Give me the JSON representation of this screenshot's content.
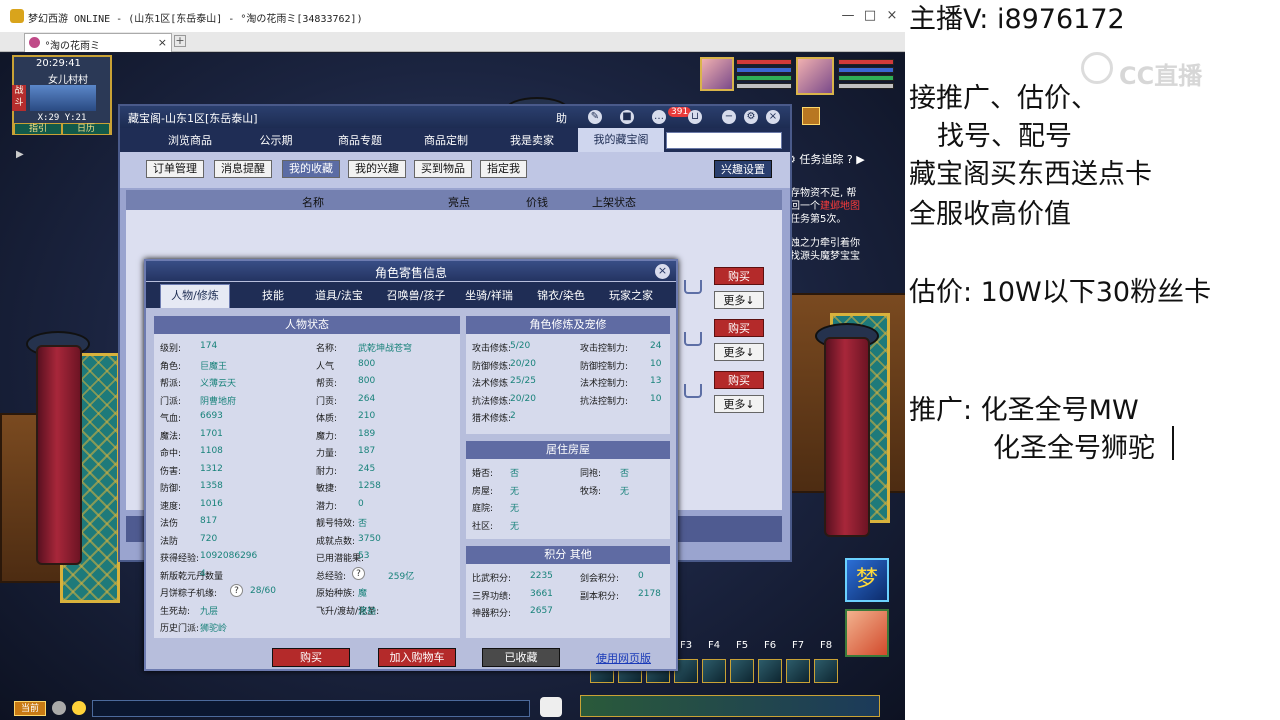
{
  "window": {
    "title": "梦幻西游 ONLINE - (山东1区[东岳泰山] - °淘の花雨ミ[34833762])",
    "tab_title": "°淘の花雨ミ",
    "tab_close": "×",
    "tab_add": "+",
    "min": "—",
    "max": "□",
    "close": "×"
  },
  "hud": {
    "time": "20:29:41",
    "location": "女儿村村",
    "coords": "X:29  Y:21",
    "side_tag": "战斗",
    "map_btns": [
      "指引",
      "日历"
    ],
    "quest_tracker": "任务追踪",
    "quest_line1": "存物资不足, 帮",
    "quest_line2": "回一个",
    "quest_hl1": "建邺地图",
    "quest_line3": "任务第5次。",
    "quest_line4": "蚀之力牵引着你",
    "quest_line5": "找源头",
    "quest_hl2": "魔梦宝宝",
    "chat_label": "当前",
    "fkeys": [
      "F3",
      "F4",
      "F5",
      "F6",
      "F7",
      "F8"
    ]
  },
  "shop": {
    "title": "藏宝阁-山东1区[东岳泰山]",
    "help": "助",
    "cart_badge": "391",
    "nav": [
      "浏览商品",
      "公示期",
      "商品专题",
      "商品定制",
      "我是卖家",
      "我的藏宝阁"
    ],
    "sub": [
      "订单管理",
      "消息提醒",
      "我的收藏",
      "我的兴趣",
      "买到物品",
      "指定我"
    ],
    "interest_settings": "兴趣设置",
    "columns": [
      "名称",
      "亮点",
      "价钱",
      "上架状态"
    ],
    "buy": "购买",
    "more": "更多↓"
  },
  "dialog": {
    "title": "角色寄售信息",
    "close": "×",
    "tabs": [
      "人物/修炼",
      "技能",
      "道具/法宝",
      "召唤兽/孩子",
      "坐骑/祥瑞",
      "锦衣/染色",
      "玩家之家"
    ],
    "status_header": "人物状态",
    "cultivation_header": "角色修炼及宠修",
    "housing_header": "居住房屋",
    "points_header": "积分 其他",
    "left_col": [
      [
        "级别:",
        "174"
      ],
      [
        "角色:",
        "巨魔王"
      ],
      [
        "帮派:",
        "义薄云天"
      ],
      [
        "门派:",
        "阴曹地府"
      ],
      [
        "气血:",
        "6693"
      ],
      [
        "魔法:",
        "1701"
      ],
      [
        "命中:",
        "1108"
      ],
      [
        "伤害:",
        "1312"
      ],
      [
        "防御:",
        "1358"
      ],
      [
        "速度:",
        "1016"
      ],
      [
        "法伤",
        "817"
      ],
      [
        "法防",
        "720"
      ],
      [
        "获得经验:",
        "1092086296"
      ],
      [
        "新版乾元丹数量",
        "4"
      ],
      [
        "月饼粽子机缘:",
        "28/60"
      ],
      [
        "生死劫:",
        "九层"
      ],
      [
        "历史门派:",
        "狮驼岭"
      ]
    ],
    "mid_col": [
      [
        "名称:",
        "武乾坤战苍穹"
      ],
      [
        "人气",
        "800"
      ],
      [
        "帮贡:",
        "800"
      ],
      [
        "门贡:",
        "264"
      ],
      [
        "体质:",
        "210"
      ],
      [
        "魔力:",
        "189"
      ],
      [
        "力量:",
        "187"
      ],
      [
        "耐力:",
        "245"
      ],
      [
        "敏捷:",
        "1258"
      ],
      [
        "潜力:",
        "0"
      ],
      [
        "靓号特效:",
        "否"
      ],
      [
        "成就点数:",
        "3750"
      ],
      [
        "已用潜能果:",
        "53"
      ],
      [
        "总经验:",
        "259亿"
      ],
      [
        "原始种族:",
        "魔"
      ],
      [
        "飞升/渡劫/化圣:",
        "渡劫"
      ]
    ],
    "cult_left": [
      [
        "攻击修炼:",
        "5/20"
      ],
      [
        "防御修炼:",
        "20/20"
      ],
      [
        "法术修炼",
        "25/25"
      ],
      [
        "抗法修炼:",
        "20/20"
      ],
      [
        "猎术修炼:",
        "2"
      ]
    ],
    "cult_right": [
      [
        "攻击控制力:",
        "24"
      ],
      [
        "防御控制力:",
        "10"
      ],
      [
        "法术控制力:",
        "13"
      ],
      [
        "抗法控制力:",
        "10"
      ]
    ],
    "house_left": [
      [
        "婚否:",
        "否"
      ],
      [
        "房屋:",
        "无"
      ],
      [
        "庭院:",
        "无"
      ],
      [
        "社区:",
        "无"
      ]
    ],
    "house_right": [
      [
        "同袍:",
        "否"
      ],
      [
        "牧场:",
        "无"
      ]
    ],
    "points_left": [
      [
        "比武积分:",
        "2235"
      ],
      [
        "三界功绩:",
        "3661"
      ],
      [
        "神器积分:",
        "2657"
      ]
    ],
    "points_right": [
      [
        "剑会积分:",
        "0"
      ],
      [
        "副本积分:",
        "2178"
      ]
    ],
    "qmark": "?",
    "btn_buy": "购买",
    "btn_cart": "加入购物车",
    "btn_fav": "已收藏",
    "link_web": "使用网页版"
  },
  "overlay": {
    "lines": [
      "主播V: i8976172",
      "接推广、估价、",
      "找号、配号",
      "藏宝阁买东西送点卡",
      "全服收高价值",
      "估价: 10W以下30粉丝卡",
      "推广: 化圣全号MW",
      "化圣全号狮驼"
    ],
    "watermark": "CC直播"
  }
}
